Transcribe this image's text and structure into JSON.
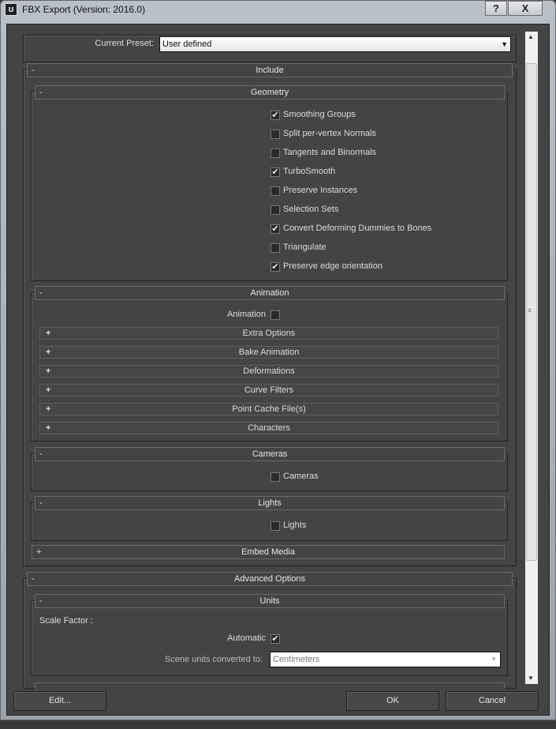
{
  "window": {
    "title": "FBX Export (Version: 2016.0)",
    "help": "?",
    "close": "X"
  },
  "preset": {
    "label": "Current Preset:",
    "value": "User defined"
  },
  "include": {
    "label": "Include",
    "sign": "-",
    "geometry": {
      "label": "Geometry",
      "sign": "-",
      "items": [
        {
          "label": "Smoothing Groups",
          "checked": true
        },
        {
          "label": "Split per-vertex Normals",
          "checked": false
        },
        {
          "label": "Tangents and Binormals",
          "checked": false
        },
        {
          "label": "TurboSmooth",
          "checked": true
        },
        {
          "label": "Preserve Instances",
          "checked": false
        },
        {
          "label": "Selection Sets",
          "checked": false
        },
        {
          "label": "Convert Deforming Dummies to Bones",
          "checked": true
        },
        {
          "label": "Triangulate",
          "checked": false
        },
        {
          "label": "Preserve edge orientation",
          "checked": true
        }
      ]
    },
    "animation": {
      "label": "Animation",
      "sign": "-",
      "checkbox_label": "Animation",
      "checked": false,
      "subs": [
        "Extra Options",
        "Bake Animation",
        "Deformations",
        "Curve Filters",
        "Point Cache File(s)",
        "Characters"
      ],
      "sub_sign": "+"
    },
    "cameras": {
      "label": "Cameras",
      "sign": "-",
      "checkbox_label": "Cameras",
      "checked": false
    },
    "lights": {
      "label": "Lights",
      "sign": "-",
      "checkbox_label": "Lights",
      "checked": false
    },
    "embed": {
      "label": "Embed Media",
      "sign": "+"
    }
  },
  "advanced": {
    "label": "Advanced Options",
    "sign": "-",
    "units": {
      "label": "Units",
      "sign": "-",
      "scale_factor": "Scale Factor :",
      "automatic_label": "Automatic",
      "automatic_checked": true,
      "scene_units_label": "Scene units converted to:",
      "scene_units_value": "Centimeters"
    }
  },
  "buttons": {
    "edit": "Edit...",
    "ok": "OK",
    "cancel": "Cancel"
  },
  "check_glyph": "✔"
}
